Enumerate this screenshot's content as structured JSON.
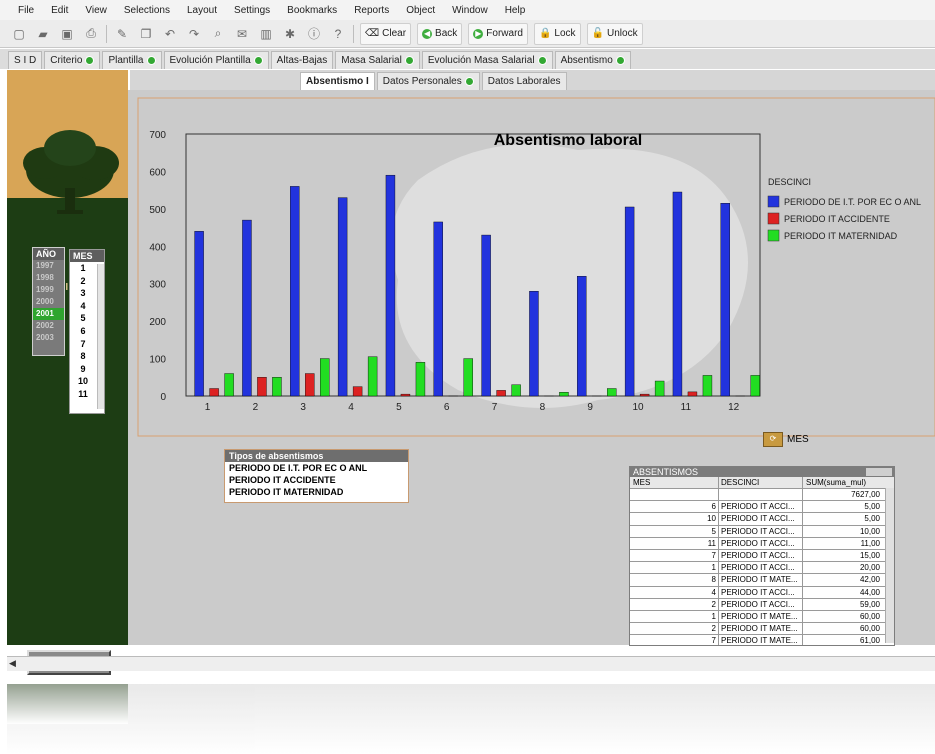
{
  "menu": [
    "File",
    "Edit",
    "View",
    "Selections",
    "Layout",
    "Settings",
    "Bookmarks",
    "Reports",
    "Object",
    "Window",
    "Help"
  ],
  "toolbar": {
    "clear": "Clear",
    "back": "Back",
    "forward": "Forward",
    "lock": "Lock",
    "unlock": "Unlock"
  },
  "tabs_row1": [
    {
      "label": "S I D",
      "dot": false
    },
    {
      "label": "Criterio",
      "dot": true
    },
    {
      "label": "Plantilla",
      "dot": true
    },
    {
      "label": "Evolución Plantilla",
      "dot": true
    },
    {
      "label": "Altas-Bajas",
      "dot": false
    },
    {
      "label": "Masa Salarial",
      "dot": true
    },
    {
      "label": "Evolución Masa Salarial",
      "dot": true
    },
    {
      "label": "Absentismo",
      "dot": true
    }
  ],
  "tabs_row2": [
    {
      "label": "Absentismo I",
      "active": true
    },
    {
      "label": "Datos Personales",
      "dot": true
    },
    {
      "label": "Datos Laborales",
      "dot": false
    }
  ],
  "sidebar": {
    "sid_label": "SID",
    "anio_header": "AÑO",
    "years": [
      "1997",
      "1998",
      "1999",
      "2000",
      "2001",
      "2002",
      "2003"
    ],
    "selected_year": "2001",
    "mes_header": "MES",
    "months": [
      "1",
      "2",
      "3",
      "4",
      "5",
      "6",
      "7",
      "8",
      "9",
      "10",
      "11"
    ],
    "inicio_button": "Inicio"
  },
  "chart_data": {
    "type": "bar",
    "title": "Absentismo laboral",
    "categories": [
      "1",
      "2",
      "3",
      "4",
      "5",
      "6",
      "7",
      "8",
      "9",
      "10",
      "11",
      "12"
    ],
    "ylim": [
      0,
      700
    ],
    "yticks": [
      "0",
      "100",
      "200",
      "300",
      "400",
      "500",
      "600",
      "700"
    ],
    "legend_title": "DESCINCI",
    "legend_position": "right",
    "series": [
      {
        "name": "PERIODO DE I.T. POR EC O ANL",
        "color": "#2233dd",
        "values": [
          440,
          470,
          560,
          530,
          590,
          465,
          430,
          280,
          320,
          505,
          545,
          515
        ]
      },
      {
        "name": "PERIODO IT ACCIDENTE",
        "color": "#dd2222",
        "values": [
          20,
          50,
          60,
          25,
          5,
          0,
          15,
          0,
          0,
          5,
          11,
          0
        ]
      },
      {
        "name": "PERIODO IT MATERNIDAD",
        "color": "#22dd22",
        "values": [
          60,
          50,
          100,
          105,
          90,
          100,
          30,
          10,
          20,
          40,
          55,
          55
        ]
      }
    ]
  },
  "chart_extra": {
    "mes_label": "MES"
  },
  "tipos": {
    "title": "Tipos de absentismos",
    "items": [
      "PERIODO DE I.T. POR EC O ANL",
      "PERIODO IT ACCIDENTE",
      "PERIODO IT MATERNIDAD"
    ]
  },
  "abs_table": {
    "title": "ABSENTISMOS",
    "headers": [
      "MES",
      "DESCINCI",
      "SUM(suma_mul)"
    ],
    "total": "7627,00",
    "rows": [
      [
        "6",
        "PERIODO IT ACCI...",
        "5,00"
      ],
      [
        "10",
        "PERIODO IT ACCI...",
        "5,00"
      ],
      [
        "5",
        "PERIODO IT ACCI...",
        "10,00"
      ],
      [
        "11",
        "PERIODO IT ACCI...",
        "11,00"
      ],
      [
        "7",
        "PERIODO IT ACCI...",
        "15,00"
      ],
      [
        "1",
        "PERIODO IT ACCI...",
        "20,00"
      ],
      [
        "8",
        "PERIODO IT MATE...",
        "42,00"
      ],
      [
        "4",
        "PERIODO IT ACCI...",
        "44,00"
      ],
      [
        "2",
        "PERIODO IT ACCI...",
        "59,00"
      ],
      [
        "1",
        "PERIODO IT MATE...",
        "60,00"
      ],
      [
        "2",
        "PERIODO IT MATE...",
        "60,00"
      ],
      [
        "7",
        "PERIODO IT MATE...",
        "61,00"
      ]
    ]
  }
}
